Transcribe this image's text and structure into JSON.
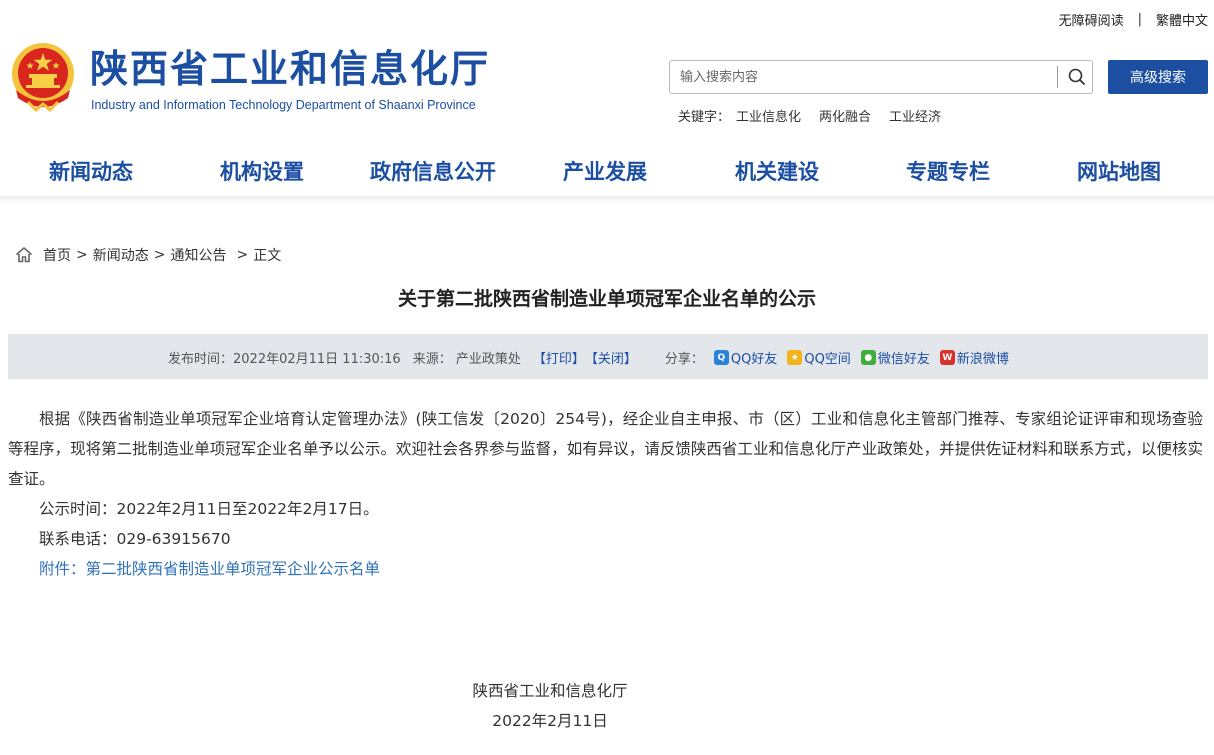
{
  "top_links": {
    "accessibility": "无障碍阅读",
    "separator": "|",
    "traditional": "繁體中文"
  },
  "header": {
    "title": "陕西省工业和信息化厅",
    "subtitle": "Industry and Information Technology Department of Shaanxi Province",
    "emblem_icon": "national-emblem"
  },
  "search": {
    "placeholder": "输入搜索内容",
    "icon": "search-icon",
    "advanced_label": "高级搜索"
  },
  "keywords": {
    "label": "关键字：",
    "items": [
      "工业信息化",
      "两化融合",
      "工业经济"
    ]
  },
  "nav": {
    "items": [
      "新闻动态",
      "机构设置",
      "政府信息公开",
      "产业发展",
      "机关建设",
      "专题专栏",
      "网站地图"
    ]
  },
  "breadcrumb": {
    "home_icon": "home-icon",
    "items": [
      "首页",
      "新闻动态",
      "通知公告",
      "正文"
    ],
    "separator": ">"
  },
  "article": {
    "title": "关于第二批陕西省制造业单项冠军企业名单的公示",
    "meta": {
      "published": "发布时间：2022年02月11日 11:30:16",
      "source": "来源： 产业政策处",
      "print": "【打印】",
      "close": "【关闭】",
      "share_label": "分享：",
      "share": [
        {
          "label": "QQ好友",
          "icon": "qq-icon",
          "color": "#2b82d9"
        },
        {
          "label": "QQ空间",
          "icon": "qzone-icon",
          "color": "#f2b31b"
        },
        {
          "label": "微信好友",
          "icon": "wechat-icon",
          "color": "#3fae3a"
        },
        {
          "label": "新浪微博",
          "icon": "weibo-icon",
          "color": "#d8322c"
        }
      ]
    },
    "body": "根据《陕西省制造业单项冠军企业培育认定管理办法》(陕工信发〔2020〕254号)，经企业自主申报、市（区）工业和信息化主管部门推荐、专家组论证评审和现场查验等程序，现将第二批制造业单项冠军企业名单予以公示。欢迎社会各界参与监督，如有异议，请反馈陕西省工业和信息化厅产业政策处，并提供佐证材料和联系方式，以便核实查证。",
    "period": "公示时间：2022年2月11日至2022年2月17日。",
    "phone": "联系电话：029-63915670",
    "attachment": "附件：第二批陕西省制造业单项冠军企业公示名单",
    "signature_org": "陕西省工业和信息化厅",
    "signature_date": "2022年2月11日"
  },
  "colors": {
    "brand": "#1c4fa1",
    "meta_bg": "#e3e7ec",
    "link": "#2f72b8"
  }
}
